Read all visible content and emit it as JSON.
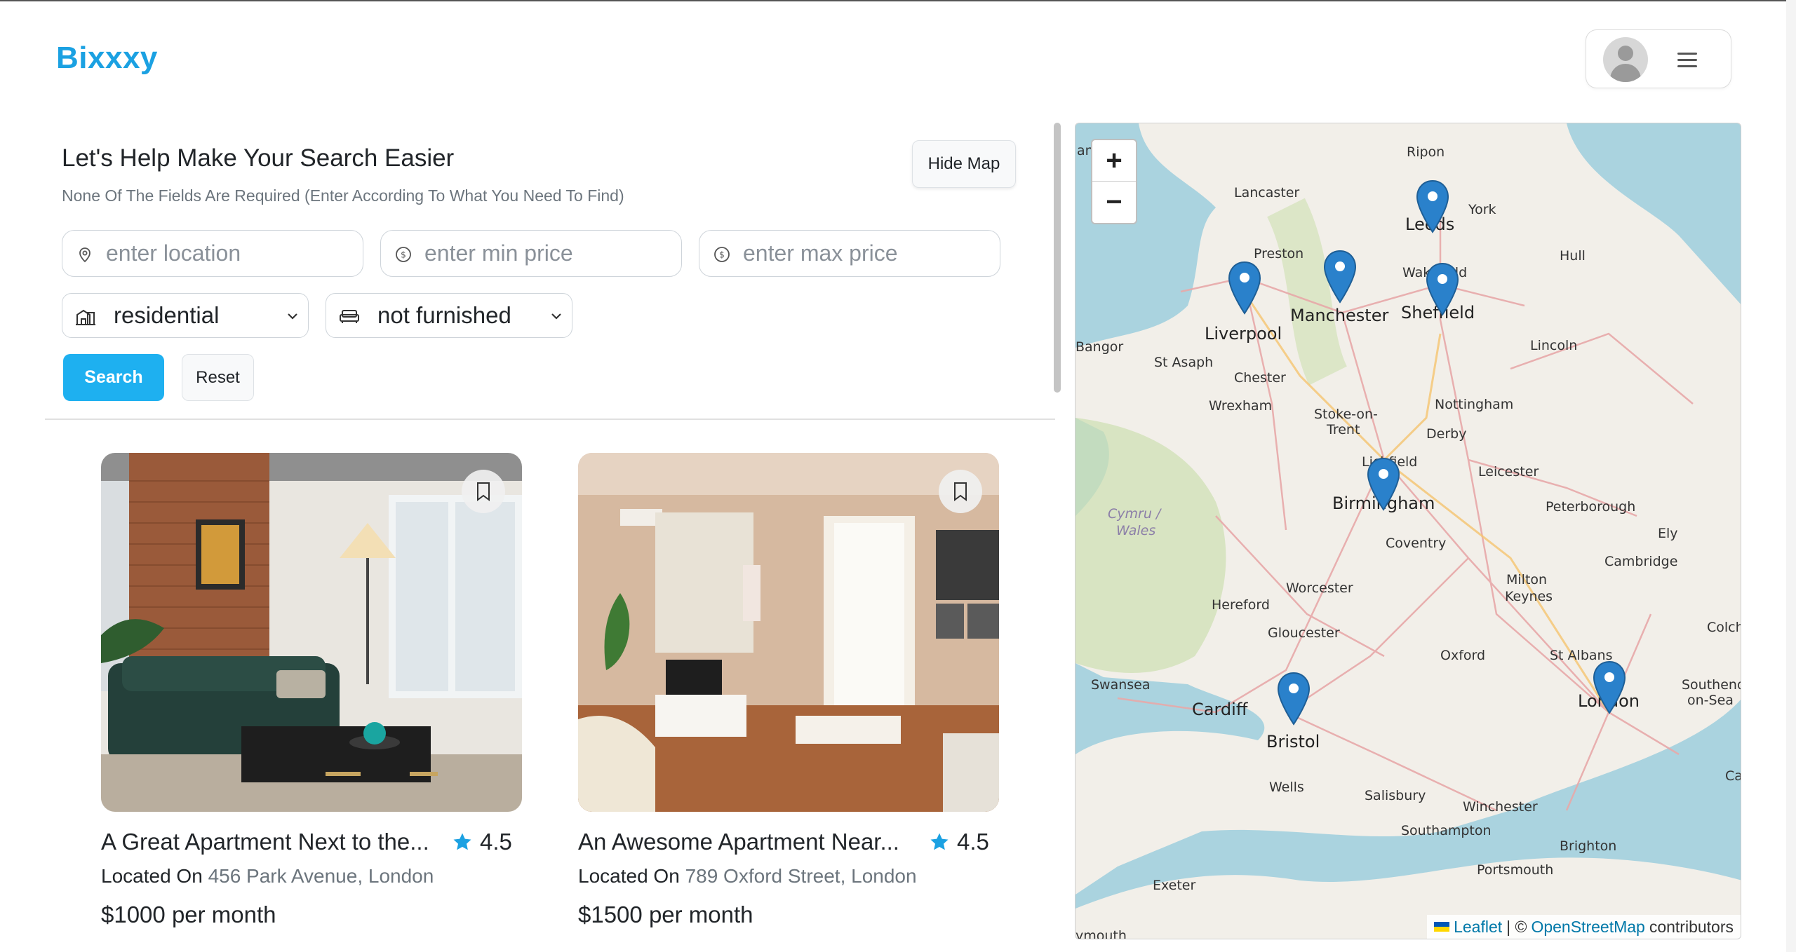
{
  "brand": {
    "name": "Bixxxy"
  },
  "search_panel": {
    "title": "Let's Help Make Your Search Easier",
    "subtitle": "None Of The Fields Are Required (Enter According To What You Need To Find)",
    "hide_map_label": "Hide Map",
    "location_placeholder": "enter location",
    "min_price_placeholder": "enter min price",
    "max_price_placeholder": "enter max price",
    "property_type": "residential",
    "furnishing": "not furnished",
    "search_label": "Search",
    "reset_label": "Reset"
  },
  "listings": [
    {
      "title": "A Great Apartment Next to the...",
      "rating": "4.5",
      "located_prefix": "Located On",
      "address": "456 Park Avenue, London",
      "price": "$1000",
      "price_suffix": "per month"
    },
    {
      "title": "An Awesome Apartment Near...",
      "rating": "4.5",
      "located_prefix": "Located On",
      "address": "789 Oxford Street, London",
      "price": "$1500",
      "price_suffix": "per month"
    }
  ],
  "map": {
    "zoom_in": "+",
    "zoom_out": "−",
    "attribution": {
      "leaflet": "Leaflet",
      "separator": "| ©",
      "osm": "OpenStreetMap",
      "contributors": "contributors"
    },
    "labels": {
      "ripon": "Ripon",
      "lancaster": "Lancaster",
      "leeds": "Leeds",
      "york": "York",
      "preston": "Preston",
      "hull": "Hull",
      "wakefield": "Wakefield",
      "manchester": "Manchester",
      "sheffield": "Sheffield",
      "liverpool": "Liverpool",
      "bangor": "Bangor",
      "st_asaph": "St Asaph",
      "lincoln": "Lincoln",
      "chester": "Chester",
      "wrexham": "Wrexham",
      "nottingham": "Nottingham",
      "stoke": "Stoke-on-",
      "trent": "Trent",
      "derby": "Derby",
      "lichfield": "Lichfield",
      "leicester": "Leicester",
      "birmingham": "Birmingham",
      "peterborough": "Peterborough",
      "cymru": "Cymru /",
      "wales": "Wales",
      "coventry": "Coventry",
      "ely": "Ely",
      "cambridge": "Cambridge",
      "hereford": "Hereford",
      "worcester": "Worcester",
      "milton": "Milton",
      "keynes": "Keynes",
      "colch": "Colch",
      "gloucester": "Gloucester",
      "oxford": "Oxford",
      "st_albans": "St Albans",
      "swansea": "Swansea",
      "cardiff": "Cardiff",
      "london": "London",
      "southend": "Southend-",
      "on_sea": "on-Sea",
      "bristol": "Bristol",
      "wells": "Wells",
      "salisbury": "Salisbury",
      "winchester": "Winchester",
      "ca": "Ca",
      "southampton": "Southampton",
      "brighton": "Brighton",
      "portsmouth": "Portsmouth",
      "exeter": "Exeter",
      "mouth": "ymouth",
      "an": "an"
    },
    "colors": {
      "marker": "#2a81cb",
      "water": "#aad3df",
      "land": "#f2efe9",
      "roads": "#e8a9a9"
    }
  },
  "icons": {
    "location": "map-pin-icon",
    "price": "dollar-circle-icon",
    "building": "building-icon",
    "sofa": "sofa-icon",
    "bookmark": "bookmark-icon",
    "star": "star-icon",
    "user": "user-avatar-icon",
    "menu": "hamburger-menu-icon"
  }
}
